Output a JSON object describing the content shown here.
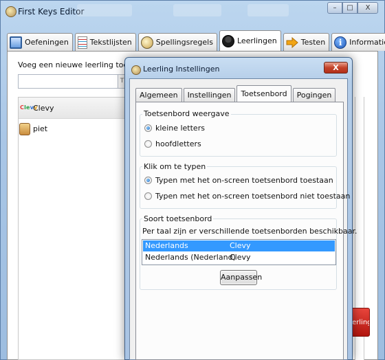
{
  "app": {
    "title": "First Keys Editor",
    "window_controls": {
      "minimize": "–",
      "maximize": "□",
      "close": "X"
    }
  },
  "main_tabs": [
    {
      "label": "Oefeningen",
      "icon": "keyboard-icon"
    },
    {
      "label": "Tekstlijsten",
      "icon": "list-icon"
    },
    {
      "label": "Spellingsregels",
      "icon": "rules-icon"
    },
    {
      "label": "Leerlingen",
      "icon": "student-icon",
      "active": true
    },
    {
      "label": "Testen",
      "icon": "arrow-right-icon"
    },
    {
      "label": "Informatie",
      "icon": "info-icon"
    }
  ],
  "leerlingen": {
    "add_label": "Voeg een nieuwe leerling toe:",
    "add_input_value": "",
    "list_header": "Clevy",
    "logo_text": "Clevy",
    "students": [
      {
        "name": "piet"
      }
    ],
    "add_button_label": "erling"
  },
  "dialog": {
    "title": "Leerling Instellingen",
    "close_label": "X",
    "tabs": [
      {
        "label": "Algemeen"
      },
      {
        "label": "Instellingen"
      },
      {
        "label": "Toetsenbord",
        "active": true
      },
      {
        "label": "Pogingen"
      }
    ],
    "weergave": {
      "title": "Toetsenbord weergave",
      "options": [
        {
          "label": "kleine letters",
          "checked": true
        },
        {
          "label": "hoofdletters",
          "checked": false
        }
      ]
    },
    "klik": {
      "title": "Klik om te typen",
      "options": [
        {
          "label": "Typen met het on-screen toetsenbord toestaan",
          "checked": true
        },
        {
          "label": "Typen met het on-screen toetsenbord niet toestaan",
          "checked": false
        }
      ]
    },
    "soort": {
      "title": "Soort toetsenbord",
      "description": "Per taal zijn er verschillende toetsenborden beschikbaar.",
      "rows": [
        {
          "language": "Nederlands",
          "keyboard": "Clevy",
          "selected": true
        },
        {
          "language": "Nederlands (Nederland)",
          "keyboard": "Clevy",
          "selected": false
        }
      ],
      "button_label": "Aanpassen"
    }
  },
  "colors": {
    "selection": "#3399ff",
    "close_button": "#c4432a",
    "add_button": "#c8221a"
  }
}
